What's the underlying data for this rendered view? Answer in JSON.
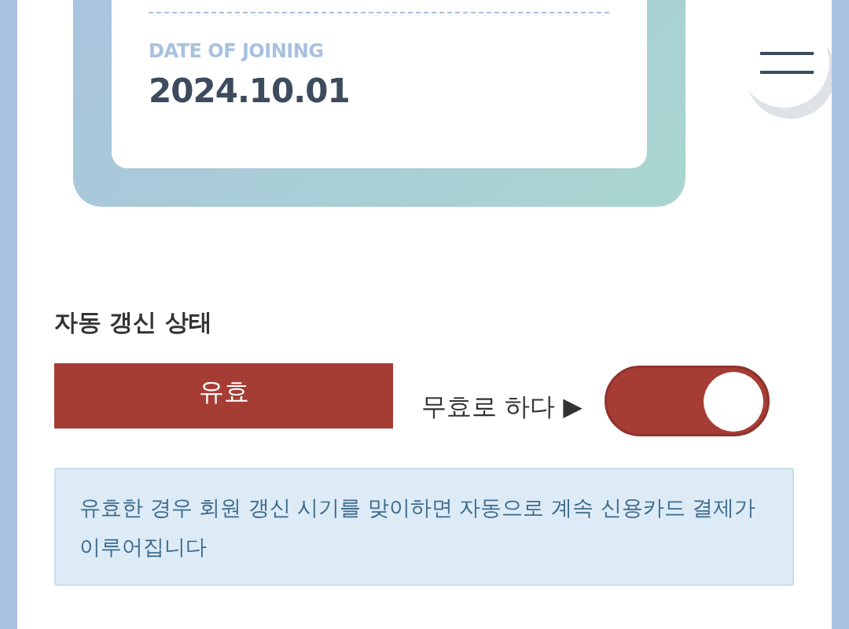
{
  "card": {
    "date_label": "DATE OF JOINING",
    "date_value": "2024.10.01"
  },
  "auto_renewal": {
    "title": "자동 갱신 상태",
    "status": "유효",
    "toggle_label": "무효로 하다 ▶",
    "on": true,
    "notice": "유효한 경우 회원 갱신 시기를 맞이하면 자동으로 계속 신용카드 결제가 이루어집니다"
  }
}
